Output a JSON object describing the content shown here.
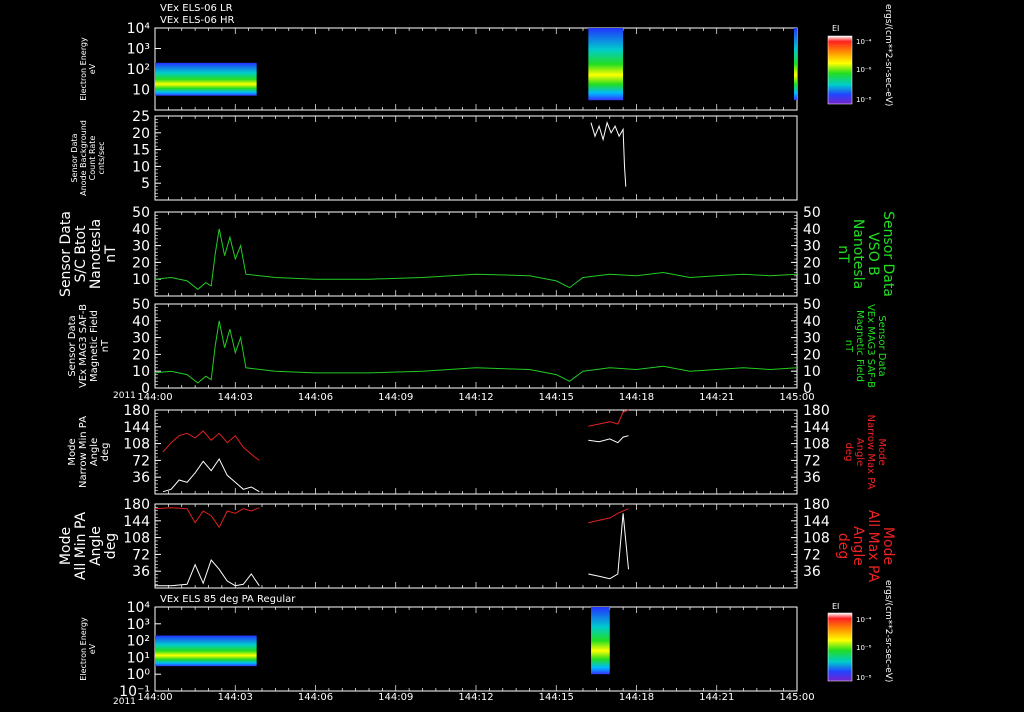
{
  "titles": {
    "top_line1": "VEx ELS-06 LR",
    "top_line2": "VEx ELS-06 HR",
    "bottom": "VEx ELS 85 deg PA Regular"
  },
  "x_axis": {
    "year": "2011",
    "ticks": [
      "144:00",
      "144:03",
      "144:06",
      "144:09",
      "144:12",
      "144:15",
      "144:18",
      "144:21",
      "145:00"
    ]
  },
  "colorbars": {
    "label": "EI",
    "ticks": [
      "10⁻⁴",
      "10⁻⁶",
      "10⁻⁸"
    ],
    "units": "ergs/(cm**2-sr-sec-eV)"
  },
  "colors": {
    "background": "#000000",
    "axis": "#ffffff",
    "green_trace": "#22cc22",
    "green_label": "#22dd22",
    "red_trace": "#dd2222",
    "red_label": "#ee2222"
  },
  "chart_data": [
    {
      "type": "heatmap",
      "panel": "electron-energy-top",
      "ylabel": [
        "Electron Energy",
        "eV"
      ],
      "yticks": [
        "10⁴",
        "10³",
        "10²",
        "10"
      ],
      "y_scale": "log",
      "ylim": [
        1,
        10000
      ],
      "blocks": [
        {
          "x_start": "144:00",
          "x_end": "144:03.8",
          "energy_range_eV": [
            5,
            200
          ]
        },
        {
          "x_start": "144:16.2",
          "x_end": "144:17.5",
          "energy_range_eV": [
            3,
            30000
          ]
        },
        {
          "x_start": "145:00",
          "x_end": "145:00",
          "energy_range_eV": [
            3,
            30000
          ]
        }
      ]
    },
    {
      "type": "line",
      "panel": "anode-background",
      "ylabel": [
        "Sensor Data",
        "Anode Background",
        "Count Rate",
        "cnts/sec"
      ],
      "ylim": [
        0,
        25
      ],
      "yticks": [
        "25",
        "20",
        "15",
        "10",
        "5"
      ],
      "x": [
        16.3,
        16.45,
        16.6,
        16.75,
        16.9,
        17.05,
        17.2,
        17.35,
        17.5,
        17.55,
        17.6
      ],
      "values": [
        23,
        19,
        22,
        18,
        23,
        20,
        22,
        19,
        21,
        10,
        4
      ]
    },
    {
      "type": "line",
      "panel": "sc-bnot",
      "ylabel": [
        "Sensor Data",
        "S/C Btot",
        "Nanotesla",
        "nT"
      ],
      "y2label": [
        "Sensor Data",
        "VSO B",
        "Nanotesla",
        "nT"
      ],
      "ylim": [
        0,
        50
      ],
      "yticks": [
        "50",
        "40",
        "30",
        "20",
        "10"
      ],
      "x": [
        0,
        0.6,
        1.2,
        1.6,
        1.9,
        2.1,
        2.25,
        2.4,
        2.6,
        2.8,
        3.0,
        3.2,
        3.4,
        4.5,
        6,
        8,
        10,
        12,
        14,
        15,
        15.5,
        16,
        17,
        18,
        19,
        20,
        21,
        22,
        23,
        24
      ],
      "values": [
        10,
        11,
        9,
        4,
        8,
        6,
        25,
        40,
        24,
        35,
        22,
        30,
        13,
        11,
        10,
        10,
        11,
        13,
        12,
        9,
        5,
        11,
        13,
        12,
        14,
        11,
        12,
        13,
        12,
        13
      ]
    },
    {
      "type": "line",
      "panel": "mag-field",
      "ylabel": [
        "Sensor Data",
        "VEx MAG3 SAF-B",
        "Magnetic Field",
        "nT"
      ],
      "y2label": [
        "Sensor Data",
        "VEx MAG3 SAF-B",
        "Magnetic Field",
        "nT"
      ],
      "ylim": [
        0,
        50
      ],
      "yticks": [
        "50",
        "40",
        "30",
        "20",
        "10",
        "0"
      ],
      "x": [
        0,
        0.6,
        1.2,
        1.6,
        1.9,
        2.1,
        2.25,
        2.4,
        2.6,
        2.8,
        3.0,
        3.2,
        3.4,
        4.5,
        6,
        8,
        10,
        12,
        14,
        15,
        15.5,
        16,
        17,
        18,
        19,
        20,
        21,
        22,
        23,
        24
      ],
      "values": [
        9,
        10,
        8,
        3,
        7,
        5,
        25,
        40,
        24,
        35,
        21,
        30,
        12,
        10,
        9,
        9,
        10,
        12,
        11,
        8,
        4,
        10,
        12,
        11,
        13,
        10,
        11,
        12,
        11,
        12
      ]
    },
    {
      "type": "line",
      "panel": "narrow-pa",
      "ylabel": [
        "Mode",
        "Narrow Min PA",
        "Angle",
        "deg"
      ],
      "y2label": [
        "Mode",
        "Narrow Max PA",
        "Angle",
        "deg"
      ],
      "ylim": [
        0,
        180
      ],
      "yticks": [
        "180",
        "144",
        "108",
        "72",
        "36"
      ],
      "series": [
        {
          "color": "red",
          "x": [
            0.3,
            0.6,
            0.9,
            1.2,
            1.5,
            1.8,
            2.1,
            2.4,
            2.7,
            3.0,
            3.3,
            3.6,
            3.9,
            16.2,
            16.6,
            17.0,
            17.3,
            17.5,
            17.7
          ],
          "values": [
            90,
            110,
            125,
            130,
            120,
            135,
            115,
            130,
            110,
            125,
            100,
            85,
            72,
            145,
            150,
            155,
            150,
            175,
            180
          ]
        },
        {
          "color": "white",
          "x": [
            0.3,
            0.6,
            0.9,
            1.2,
            1.5,
            1.8,
            2.1,
            2.4,
            2.7,
            3.0,
            3.3,
            3.6,
            3.9,
            16.2,
            16.6,
            17.0,
            17.3,
            17.5,
            17.7
          ],
          "values": [
            5,
            10,
            30,
            25,
            45,
            70,
            50,
            75,
            40,
            25,
            10,
            15,
            5,
            115,
            112,
            118,
            110,
            122,
            125
          ]
        }
      ]
    },
    {
      "type": "line",
      "panel": "all-pa",
      "ylabel": [
        "Mode",
        "All Min PA",
        "Angle",
        "deg"
      ],
      "y2label": [
        "Mode",
        "All Max PA",
        "Angle",
        "deg"
      ],
      "ylim": [
        0,
        180
      ],
      "yticks": [
        "180",
        "144",
        "108",
        "72",
        "36"
      ],
      "series": [
        {
          "color": "red",
          "x": [
            0,
            0.6,
            1.2,
            1.5,
            1.8,
            2.1,
            2.4,
            2.7,
            3.0,
            3.3,
            3.6,
            3.9,
            16.2,
            16.6,
            17.0,
            17.3,
            17.5,
            17.7
          ],
          "values": [
            170,
            172,
            170,
            140,
            165,
            155,
            130,
            165,
            160,
            170,
            165,
            172,
            140,
            145,
            150,
            160,
            165,
            170
          ]
        },
        {
          "color": "white",
          "x": [
            0,
            0.6,
            1.2,
            1.5,
            1.8,
            2.1,
            2.4,
            2.7,
            3.0,
            3.3,
            3.6,
            3.9,
            16.2,
            16.6,
            17.0,
            17.3,
            17.5,
            17.7
          ],
          "values": [
            5,
            5,
            8,
            50,
            10,
            60,
            40,
            15,
            5,
            8,
            30,
            5,
            30,
            25,
            20,
            30,
            160,
            40
          ]
        }
      ]
    },
    {
      "type": "heatmap",
      "panel": "electron-energy-bottom",
      "ylabel": [
        "Electron Energy",
        "eV"
      ],
      "yticks": [
        "10⁴",
        "10³",
        "10²",
        "10¹",
        "10⁰",
        "10⁻¹"
      ],
      "y_scale": "log",
      "ylim": [
        0.1,
        10000
      ],
      "blocks": [
        {
          "x_start": "144:00",
          "x_end": "144:03.8",
          "energy_range_eV": [
            3,
            200
          ]
        },
        {
          "x_start": "144:16.3",
          "x_end": "144:17.0",
          "energy_range_eV": [
            1,
            30000
          ]
        }
      ]
    }
  ]
}
